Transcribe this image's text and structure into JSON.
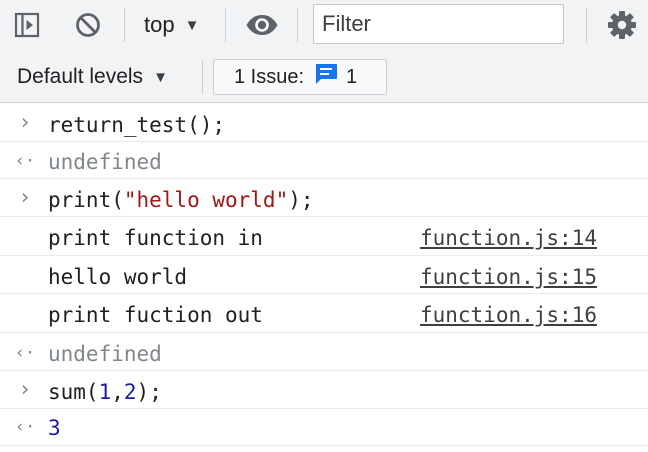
{
  "toolbar": {
    "context": "top",
    "filter_placeholder": "Filter",
    "levels": "Default levels",
    "issues_label": "1 Issue:",
    "issues_count": "1"
  },
  "console": {
    "rows": [
      {
        "kind": "input",
        "code_a": "return_test();"
      },
      {
        "kind": "output",
        "text": "undefined"
      },
      {
        "kind": "input",
        "code_a": "print(",
        "code_str": "\"hello world\"",
        "code_b": ");"
      },
      {
        "kind": "log",
        "text": "print function in",
        "source": "function.js:14"
      },
      {
        "kind": "log",
        "text": "hello world",
        "source": "function.js:15"
      },
      {
        "kind": "log",
        "text": "print fuction out",
        "source": "function.js:16"
      },
      {
        "kind": "output",
        "text": "undefined"
      },
      {
        "kind": "input",
        "code_a": "sum(",
        "num1": "1",
        "comma": ",",
        "num2": "2",
        "code_b": ");"
      },
      {
        "kind": "output",
        "text": "3"
      }
    ]
  },
  "icons": [
    "sidebar-toggle-icon",
    "clear-console-icon",
    "eye-icon",
    "gear-icon",
    "message-icon",
    "prompt-chevron-icon",
    "result-arrow-icon"
  ],
  "colors": {
    "string": "#a31515",
    "number": "#1a1aa6",
    "accent": "#1a73e8"
  }
}
